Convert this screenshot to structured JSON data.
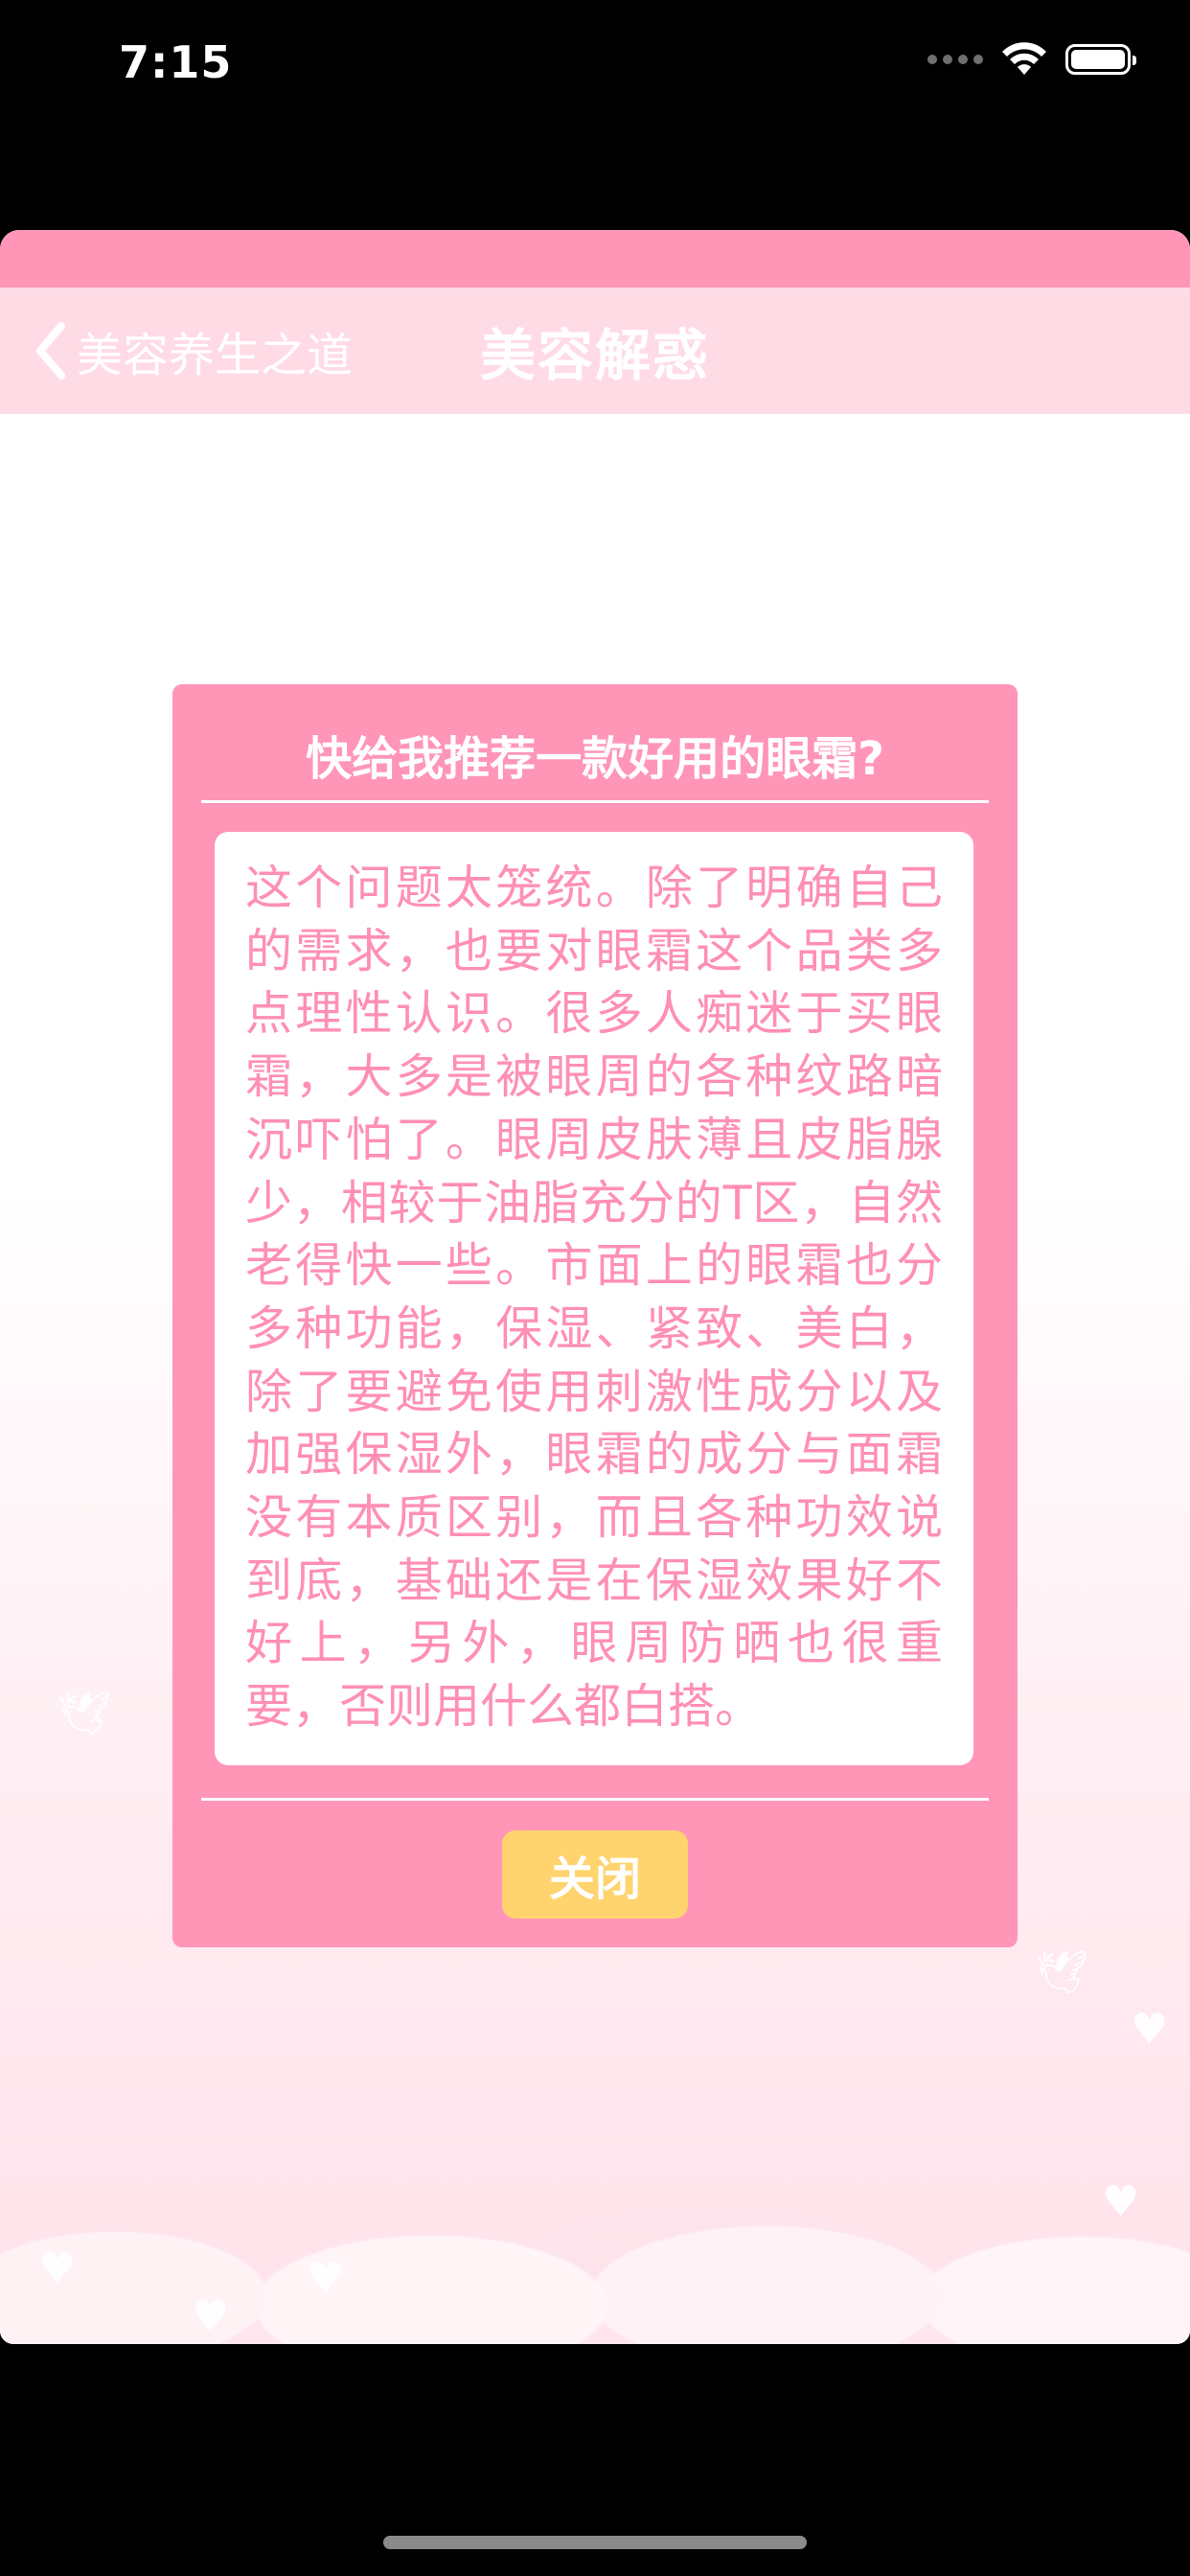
{
  "status_bar": {
    "time": "7:15"
  },
  "navbar": {
    "back_label": "美容养生之道",
    "title": "美容解惑"
  },
  "dialog": {
    "question": "快给我推荐一款好用的眼霜?",
    "answer": "这个问题太笼统。除了明确自己的需求，也要对眼霜这个品类多点理性认识。很多人痴迷于买眼霜，大多是被眼周的各种纹路暗沉吓怕了。眼周皮肤薄且皮脂腺少，相较于油脂充分的T区，自然老得快一些。市面上的眼霜也分多种功能，保湿、紧致、美白，除了要避免使用刺激性成分以及加强保湿外，眼霜的成分与面霜没有本质区别，而且各种功效说到底，基础还是在保湿效果好不好上，另外，眼周防晒也很重要，否则用什么都白搭。",
    "close_label": "关闭"
  },
  "colors": {
    "accent_pink": "#ff96b7",
    "navbar_pink": "#ffdbe6",
    "answer_text": "#ff8fb3",
    "close_button": "#ffd36e"
  },
  "icons": {
    "back": "chevron-left-icon",
    "wifi": "wifi-icon",
    "battery": "battery-icon",
    "signal": "signal-icon"
  }
}
